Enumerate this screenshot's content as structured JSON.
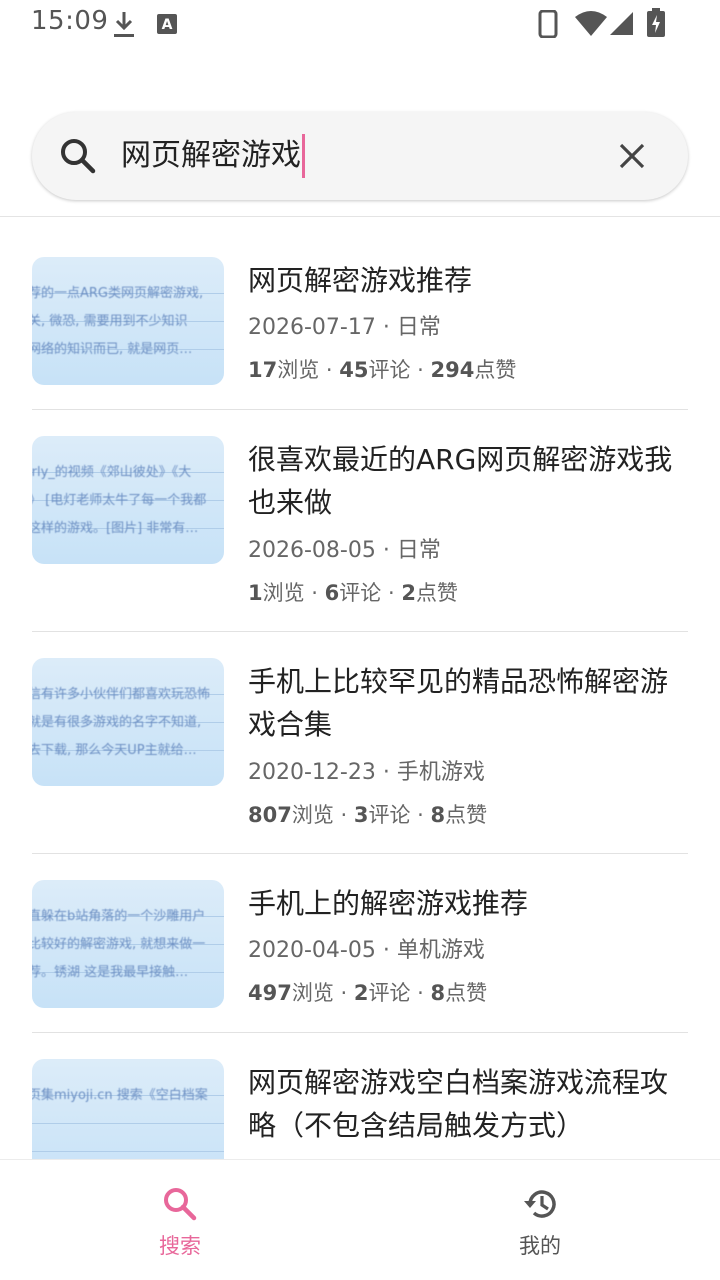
{
  "status_bar": {
    "time": "15:09",
    "left_icons": [
      "download-icon",
      "keyboard-a-icon"
    ],
    "right_icons": [
      "phone-icon",
      "wifi-icon",
      "signal-icon",
      "battery-charging-icon"
    ]
  },
  "search": {
    "query": "网页解密游戏",
    "caret_color": "#e8679a"
  },
  "results": [
    {
      "title": "网页解密游戏推荐",
      "date": "2026-07-17",
      "category": "日常",
      "views": "17",
      "comments": "45",
      "likes": "294",
      "thumb_lines": [
        "荐的一点ARG类网页解密游戏,",
        "关, 微恐, 需要用到不少知识",
        "网络的知识而已, 就是网页…"
      ]
    },
    {
      "title": "很喜欢最近的ARG网页解密游戏我也来做",
      "date": "2026-08-05",
      "category": "日常",
      "views": "1",
      "comments": "6",
      "likes": "2",
      "thumb_lines": [
        "irly_的视频《郊山彼处》《大",
        "》 [电灯老师太牛了每一个我都",
        "这样的游戏。[图片] 非常有…"
      ]
    },
    {
      "title": "手机上比较罕见的精品恐怖解密游戏合集",
      "date": "2020-12-23",
      "category": "手机游戏",
      "views": "807",
      "comments": "3",
      "likes": "8",
      "thumb_lines": [
        "信有许多小伙伴们都喜欢玩恐怖",
        "就是有很多游戏的名字不知道,",
        "去下载, 那么今天UP主就给…"
      ]
    },
    {
      "title": "手机上的解密游戏推荐",
      "date": "2020-04-05",
      "category": "单机游戏",
      "views": "497",
      "comments": "2",
      "likes": "8",
      "thumb_lines": [
        "直躲在b站角落的一个沙雕用户",
        "比较好的解密游戏, 就想来做一",
        "荐。锈湖   这是我最早接触…"
      ]
    },
    {
      "title": "网页解密游戏空白档案游戏流程攻略（不包含结局触发方式）",
      "thumb_lines": [
        "页集miyoji.cn 搜索《空白档案"
      ]
    }
  ],
  "labels": {
    "views_suffix": "浏览",
    "comments_suffix": "评论",
    "likes_suffix": "点赞",
    "sep": " · "
  },
  "bottom_nav": {
    "tabs": [
      {
        "label": "搜索",
        "icon": "search-icon",
        "active": true
      },
      {
        "label": "我的",
        "icon": "history-icon",
        "active": false
      }
    ],
    "active_color": "#e8679a",
    "inactive_color": "#555555"
  }
}
